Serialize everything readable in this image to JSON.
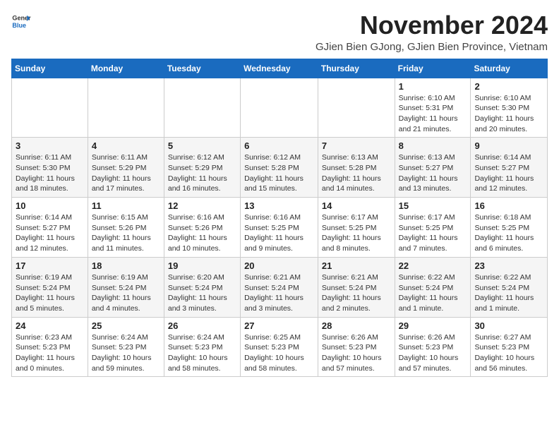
{
  "header": {
    "logo_general": "General",
    "logo_blue": "Blue",
    "month_title": "November 2024",
    "location": "GJien Bien GJong, GJien Bien Province, Vietnam"
  },
  "days_of_week": [
    "Sunday",
    "Monday",
    "Tuesday",
    "Wednesday",
    "Thursday",
    "Friday",
    "Saturday"
  ],
  "weeks": [
    {
      "days": [
        {
          "num": "",
          "info": ""
        },
        {
          "num": "",
          "info": ""
        },
        {
          "num": "",
          "info": ""
        },
        {
          "num": "",
          "info": ""
        },
        {
          "num": "",
          "info": ""
        },
        {
          "num": "1",
          "info": "Sunrise: 6:10 AM\nSunset: 5:31 PM\nDaylight: 11 hours\nand 21 minutes."
        },
        {
          "num": "2",
          "info": "Sunrise: 6:10 AM\nSunset: 5:30 PM\nDaylight: 11 hours\nand 20 minutes."
        }
      ]
    },
    {
      "days": [
        {
          "num": "3",
          "info": "Sunrise: 6:11 AM\nSunset: 5:30 PM\nDaylight: 11 hours\nand 18 minutes."
        },
        {
          "num": "4",
          "info": "Sunrise: 6:11 AM\nSunset: 5:29 PM\nDaylight: 11 hours\nand 17 minutes."
        },
        {
          "num": "5",
          "info": "Sunrise: 6:12 AM\nSunset: 5:29 PM\nDaylight: 11 hours\nand 16 minutes."
        },
        {
          "num": "6",
          "info": "Sunrise: 6:12 AM\nSunset: 5:28 PM\nDaylight: 11 hours\nand 15 minutes."
        },
        {
          "num": "7",
          "info": "Sunrise: 6:13 AM\nSunset: 5:28 PM\nDaylight: 11 hours\nand 14 minutes."
        },
        {
          "num": "8",
          "info": "Sunrise: 6:13 AM\nSunset: 5:27 PM\nDaylight: 11 hours\nand 13 minutes."
        },
        {
          "num": "9",
          "info": "Sunrise: 6:14 AM\nSunset: 5:27 PM\nDaylight: 11 hours\nand 12 minutes."
        }
      ]
    },
    {
      "days": [
        {
          "num": "10",
          "info": "Sunrise: 6:14 AM\nSunset: 5:27 PM\nDaylight: 11 hours\nand 12 minutes."
        },
        {
          "num": "11",
          "info": "Sunrise: 6:15 AM\nSunset: 5:26 PM\nDaylight: 11 hours\nand 11 minutes."
        },
        {
          "num": "12",
          "info": "Sunrise: 6:16 AM\nSunset: 5:26 PM\nDaylight: 11 hours\nand 10 minutes."
        },
        {
          "num": "13",
          "info": "Sunrise: 6:16 AM\nSunset: 5:25 PM\nDaylight: 11 hours\nand 9 minutes."
        },
        {
          "num": "14",
          "info": "Sunrise: 6:17 AM\nSunset: 5:25 PM\nDaylight: 11 hours\nand 8 minutes."
        },
        {
          "num": "15",
          "info": "Sunrise: 6:17 AM\nSunset: 5:25 PM\nDaylight: 11 hours\nand 7 minutes."
        },
        {
          "num": "16",
          "info": "Sunrise: 6:18 AM\nSunset: 5:25 PM\nDaylight: 11 hours\nand 6 minutes."
        }
      ]
    },
    {
      "days": [
        {
          "num": "17",
          "info": "Sunrise: 6:19 AM\nSunset: 5:24 PM\nDaylight: 11 hours\nand 5 minutes."
        },
        {
          "num": "18",
          "info": "Sunrise: 6:19 AM\nSunset: 5:24 PM\nDaylight: 11 hours\nand 4 minutes."
        },
        {
          "num": "19",
          "info": "Sunrise: 6:20 AM\nSunset: 5:24 PM\nDaylight: 11 hours\nand 3 minutes."
        },
        {
          "num": "20",
          "info": "Sunrise: 6:21 AM\nSunset: 5:24 PM\nDaylight: 11 hours\nand 3 minutes."
        },
        {
          "num": "21",
          "info": "Sunrise: 6:21 AM\nSunset: 5:24 PM\nDaylight: 11 hours\nand 2 minutes."
        },
        {
          "num": "22",
          "info": "Sunrise: 6:22 AM\nSunset: 5:24 PM\nDaylight: 11 hours\nand 1 minute."
        },
        {
          "num": "23",
          "info": "Sunrise: 6:22 AM\nSunset: 5:24 PM\nDaylight: 11 hours\nand 1 minute."
        }
      ]
    },
    {
      "days": [
        {
          "num": "24",
          "info": "Sunrise: 6:23 AM\nSunset: 5:23 PM\nDaylight: 11 hours\nand 0 minutes."
        },
        {
          "num": "25",
          "info": "Sunrise: 6:24 AM\nSunset: 5:23 PM\nDaylight: 10 hours\nand 59 minutes."
        },
        {
          "num": "26",
          "info": "Sunrise: 6:24 AM\nSunset: 5:23 PM\nDaylight: 10 hours\nand 58 minutes."
        },
        {
          "num": "27",
          "info": "Sunrise: 6:25 AM\nSunset: 5:23 PM\nDaylight: 10 hours\nand 58 minutes."
        },
        {
          "num": "28",
          "info": "Sunrise: 6:26 AM\nSunset: 5:23 PM\nDaylight: 10 hours\nand 57 minutes."
        },
        {
          "num": "29",
          "info": "Sunrise: 6:26 AM\nSunset: 5:23 PM\nDaylight: 10 hours\nand 57 minutes."
        },
        {
          "num": "30",
          "info": "Sunrise: 6:27 AM\nSunset: 5:23 PM\nDaylight: 10 hours\nand 56 minutes."
        }
      ]
    }
  ]
}
